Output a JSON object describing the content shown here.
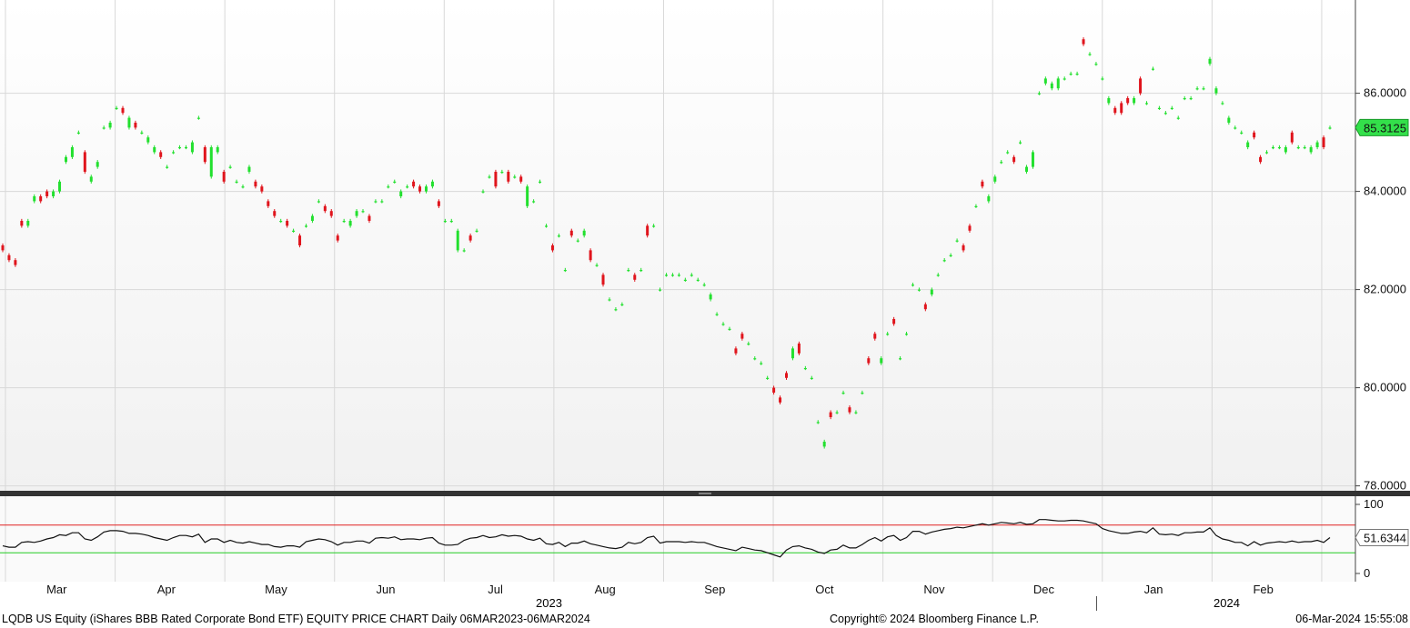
{
  "footer": {
    "left": "LQDB US Equity (iShares BBB Rated Corporate Bond ETF) EQUITY PRICE CHART  Daily 06MAR2023-06MAR2024",
    "center": "Copyright© 2024 Bloomberg Finance L.P.",
    "right": "06-Mar-2024 15:55:08"
  },
  "colors": {
    "up": "#22e02e",
    "down": "#e0141c",
    "upper_band": "#e02020",
    "lower_band": "#22cc22",
    "last_badge": "#33e04a"
  },
  "chart_data": [
    {
      "type": "candlestick",
      "title": "",
      "x_tick_labels": [
        "Mar",
        "Apr",
        "May",
        "Jun",
        "Jul",
        "Aug",
        "Sep",
        "Oct",
        "Nov",
        "Dec",
        "Jan",
        "Feb"
      ],
      "x_year_labels": [
        "2023",
        "2024"
      ],
      "y_tick_labels": [
        "78.0000",
        "80.0000",
        "82.0000",
        "84.0000",
        "86.0000"
      ],
      "ylim": [
        77.9,
        87.9
      ],
      "last_value_label": "85.3125",
      "grid": true,
      "series": [
        {
          "name": "",
          "values": [
            82.8,
            82.6,
            82.5,
            83.3,
            83.4,
            83.9,
            83.8,
            83.9,
            84.0,
            84.2,
            84.7,
            84.9,
            85.2,
            84.4,
            84.3,
            84.6,
            85.3,
            85.4,
            85.7,
            85.6,
            85.5,
            85.3,
            85.2,
            85.1,
            84.9,
            84.7,
            84.5,
            84.8,
            84.9,
            84.9,
            85.0,
            85.5,
            84.6,
            84.9,
            84.9,
            84.2,
            84.5,
            84.2,
            84.1,
            84.5,
            84.1,
            84.0,
            83.7,
            83.5,
            83.4,
            83.3,
            83.2,
            82.9,
            83.3,
            83.5,
            83.8,
            83.6,
            83.5,
            83.0,
            83.4,
            83.4,
            83.6,
            83.6,
            83.4,
            83.8,
            83.8,
            84.1,
            84.2,
            84.0,
            84.1,
            84.1,
            84.0,
            84.1,
            84.2,
            83.7,
            83.4,
            83.4,
            83.2,
            82.8,
            83.0,
            83.2,
            84.0,
            84.3,
            84.1,
            84.4,
            84.2,
            84.3,
            84.2,
            84.1,
            83.8,
            84.2,
            83.3,
            82.8,
            83.1,
            82.4,
            83.1,
            83.0,
            83.2,
            82.6,
            82.5,
            82.1,
            81.8,
            81.6,
            81.7,
            82.4,
            82.2,
            82.4,
            83.1,
            83.3,
            82.0,
            82.3,
            82.3,
            82.3,
            82.2,
            82.3,
            82.2,
            82.1,
            81.9,
            81.5,
            81.3,
            81.2,
            80.7,
            81.0,
            80.9,
            80.6,
            80.5,
            80.2,
            79.9,
            79.7,
            80.2,
            80.8,
            80.7,
            80.4,
            80.2,
            79.3,
            78.9,
            79.4,
            79.5,
            79.9,
            79.5,
            79.5,
            79.9,
            80.5,
            81.0,
            80.6,
            81.1,
            81.3,
            80.6,
            81.1,
            82.1,
            82.0,
            81.6,
            82.0,
            82.3,
            82.6,
            82.7,
            83.0,
            82.8,
            83.2,
            83.7,
            84.1,
            83.9,
            84.3,
            84.6,
            84.8,
            84.6,
            85.0,
            84.5,
            84.8,
            86.0,
            86.3,
            86.2,
            86.3,
            86.3,
            86.4,
            86.4,
            87.0,
            86.8,
            86.6,
            86.3,
            85.9,
            85.6,
            85.6,
            85.8,
            85.9,
            86.0,
            85.8,
            86.5,
            85.7,
            85.6,
            85.7,
            85.5,
            85.9,
            85.9,
            86.1,
            86.1,
            86.7,
            86.1,
            85.8,
            85.5,
            85.3,
            85.2,
            85.0,
            85.1,
            84.6,
            84.8,
            84.9,
            84.9,
            84.9,
            85.0,
            84.9,
            84.9,
            84.9,
            85.0,
            84.9,
            85.3
          ],
          "opens": [
            82.9,
            82.7,
            82.6,
            83.4,
            83.3,
            83.8,
            83.9,
            84.0,
            83.9,
            84.0,
            84.6,
            84.7,
            85.2,
            84.8,
            84.2,
            84.5,
            85.3,
            85.3,
            85.7,
            85.7,
            85.3,
            85.4,
            85.2,
            85.0,
            84.8,
            84.8,
            84.5,
            84.8,
            84.9,
            84.9,
            84.8,
            85.5,
            84.9,
            84.3,
            84.8,
            84.4,
            84.5,
            84.2,
            84.1,
            84.4,
            84.2,
            84.1,
            83.8,
            83.6,
            83.4,
            83.4,
            83.2,
            83.1,
            83.3,
            83.4,
            83.8,
            83.7,
            83.6,
            83.1,
            83.4,
            83.3,
            83.5,
            83.6,
            83.5,
            83.8,
            83.8,
            84.1,
            84.2,
            83.9,
            84.1,
            84.2,
            84.1,
            84.0,
            84.1,
            83.8,
            83.4,
            83.4,
            82.8,
            82.8,
            83.1,
            83.2,
            84.0,
            84.3,
            84.4,
            84.4,
            84.4,
            84.3,
            84.3,
            83.7,
            83.8,
            84.2,
            83.3,
            82.9,
            83.1,
            82.4,
            83.2,
            83.0,
            83.1,
            82.8,
            82.5,
            82.3,
            81.8,
            81.6,
            81.7,
            82.4,
            82.3,
            82.4,
            83.3,
            83.3,
            82.0,
            82.3,
            82.3,
            82.3,
            82.2,
            82.3,
            82.2,
            82.1,
            81.8,
            81.5,
            81.3,
            81.2,
            80.8,
            81.1,
            80.9,
            80.6,
            80.5,
            80.2,
            80.0,
            79.8,
            80.3,
            80.6,
            80.9,
            80.4,
            80.2,
            79.3,
            78.8,
            79.5,
            79.5,
            79.9,
            79.6,
            79.5,
            79.9,
            80.6,
            81.1,
            80.5,
            81.1,
            81.4,
            80.6,
            81.1,
            82.1,
            82.0,
            81.7,
            81.9,
            82.3,
            82.6,
            82.7,
            83.0,
            82.9,
            83.3,
            83.7,
            84.2,
            83.8,
            84.2,
            84.6,
            84.8,
            84.7,
            85.0,
            84.4,
            84.5,
            86.0,
            86.2,
            86.1,
            86.1,
            86.3,
            86.4,
            86.4,
            87.1,
            86.8,
            86.6,
            86.3,
            85.8,
            85.7,
            85.8,
            85.9,
            85.8,
            86.3,
            85.8,
            86.5,
            85.7,
            85.6,
            85.7,
            85.5,
            85.9,
            85.9,
            86.1,
            86.1,
            86.6,
            86.0,
            85.8,
            85.4,
            85.3,
            85.2,
            84.9,
            85.2,
            84.7,
            84.8,
            84.9,
            84.9,
            84.8,
            85.2,
            84.9,
            84.9,
            84.8,
            84.9,
            85.1,
            85.3
          ]
        }
      ]
    },
    {
      "type": "line",
      "title": "",
      "y_tick_labels": [
        "100",
        "0"
      ],
      "ylim": [
        0,
        100
      ],
      "last_value_label": "51.6344",
      "reference_lines": [
        70,
        30
      ],
      "grid": true,
      "series": [
        {
          "name": "",
          "values": [
            40,
            38,
            38,
            45,
            46,
            45,
            47,
            50,
            52,
            56,
            55,
            59,
            59,
            50,
            48,
            53,
            60,
            62,
            62,
            61,
            58,
            58,
            57,
            55,
            52,
            50,
            48,
            52,
            55,
            55,
            53,
            57,
            45,
            50,
            50,
            45,
            48,
            45,
            44,
            46,
            44,
            42,
            42,
            39,
            38,
            40,
            40,
            38,
            46,
            48,
            50,
            49,
            46,
            41,
            45,
            45,
            47,
            47,
            44,
            51,
            52,
            51,
            53,
            49,
            50,
            50,
            49,
            51,
            52,
            44,
            41,
            41,
            42,
            48,
            51,
            52,
            55,
            52,
            53,
            56,
            54,
            55,
            54,
            50,
            48,
            51,
            43,
            42,
            45,
            39,
            44,
            44,
            47,
            43,
            41,
            39,
            37,
            36,
            38,
            45,
            43,
            45,
            52,
            54,
            44,
            46,
            46,
            46,
            45,
            46,
            45,
            45,
            42,
            39,
            37,
            35,
            33,
            38,
            36,
            34,
            33,
            30,
            27,
            24,
            34,
            39,
            40,
            37,
            35,
            31,
            29,
            34,
            35,
            41,
            37,
            37,
            42,
            48,
            52,
            47,
            53,
            55,
            48,
            52,
            61,
            61,
            57,
            60,
            62,
            64,
            65,
            67,
            66,
            68,
            70,
            72,
            70,
            72,
            74,
            73,
            72,
            74,
            71,
            72,
            78,
            78,
            77,
            76,
            76,
            77,
            77,
            76,
            74,
            72,
            65,
            62,
            60,
            58,
            58,
            60,
            61,
            59,
            66,
            57,
            56,
            57,
            55,
            59,
            59,
            60,
            60,
            66,
            55,
            50,
            48,
            45,
            45,
            40,
            46,
            41,
            44,
            45,
            46,
            45,
            47,
            45,
            46,
            46,
            48,
            45,
            52
          ]
        }
      ]
    }
  ]
}
